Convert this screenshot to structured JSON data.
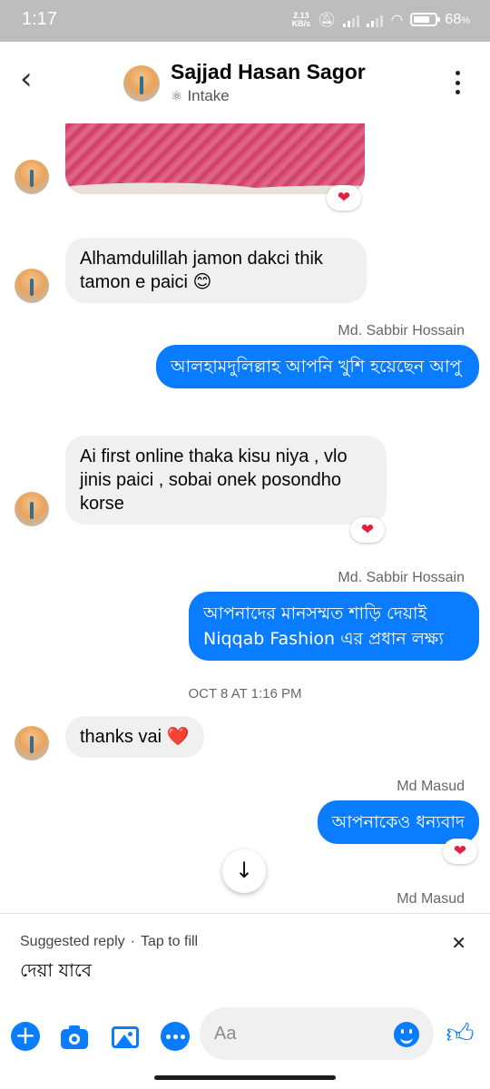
{
  "status_bar": {
    "time": "1:17",
    "speed_value": "2.13",
    "speed_unit": "KB/s",
    "battery": "68"
  },
  "header": {
    "contact_name": "Sajjad Hasan Sagor",
    "subtitle": "Intake",
    "subtitle_icon": "intake-icon"
  },
  "thread": {
    "messages": [
      {
        "text": "Alhamdulillah jamon dakci thik tamon e paici 😊"
      },
      {
        "sender": "Md. Sabbir Hossain",
        "text": "আলহামদুলিল্লাহ আপনি খুশি হয়েছেন আপু"
      },
      {
        "text": "Ai first online thaka kisu niya , vlo jinis paici , sobai onek posondho korse"
      },
      {
        "sender": "Md. Sabbir Hossain",
        "text": "আপনাদের মানসম্মত শাড়ি দেয়াই Niqqab Fashion এর প্রধান লক্ষ্য"
      },
      {
        "text": "thanks vai ❤️"
      },
      {
        "sender": "Md Masud",
        "text": "আপনাকেও ধন্যবাদ"
      }
    ],
    "timestamp": "OCT 8 AT 1:16 PM",
    "last_sender": "Md Masud",
    "reaction": "❤"
  },
  "suggested_reply": {
    "label": "Suggested reply",
    "separator": "·",
    "action": "Tap to fill",
    "text": "দেয়া যাবে"
  },
  "composer": {
    "placeholder": "Aa"
  },
  "colors": {
    "accent": "#0a7cff",
    "incoming_bubble": "#f0f0f0",
    "reaction_heart": "#e41e3f"
  }
}
